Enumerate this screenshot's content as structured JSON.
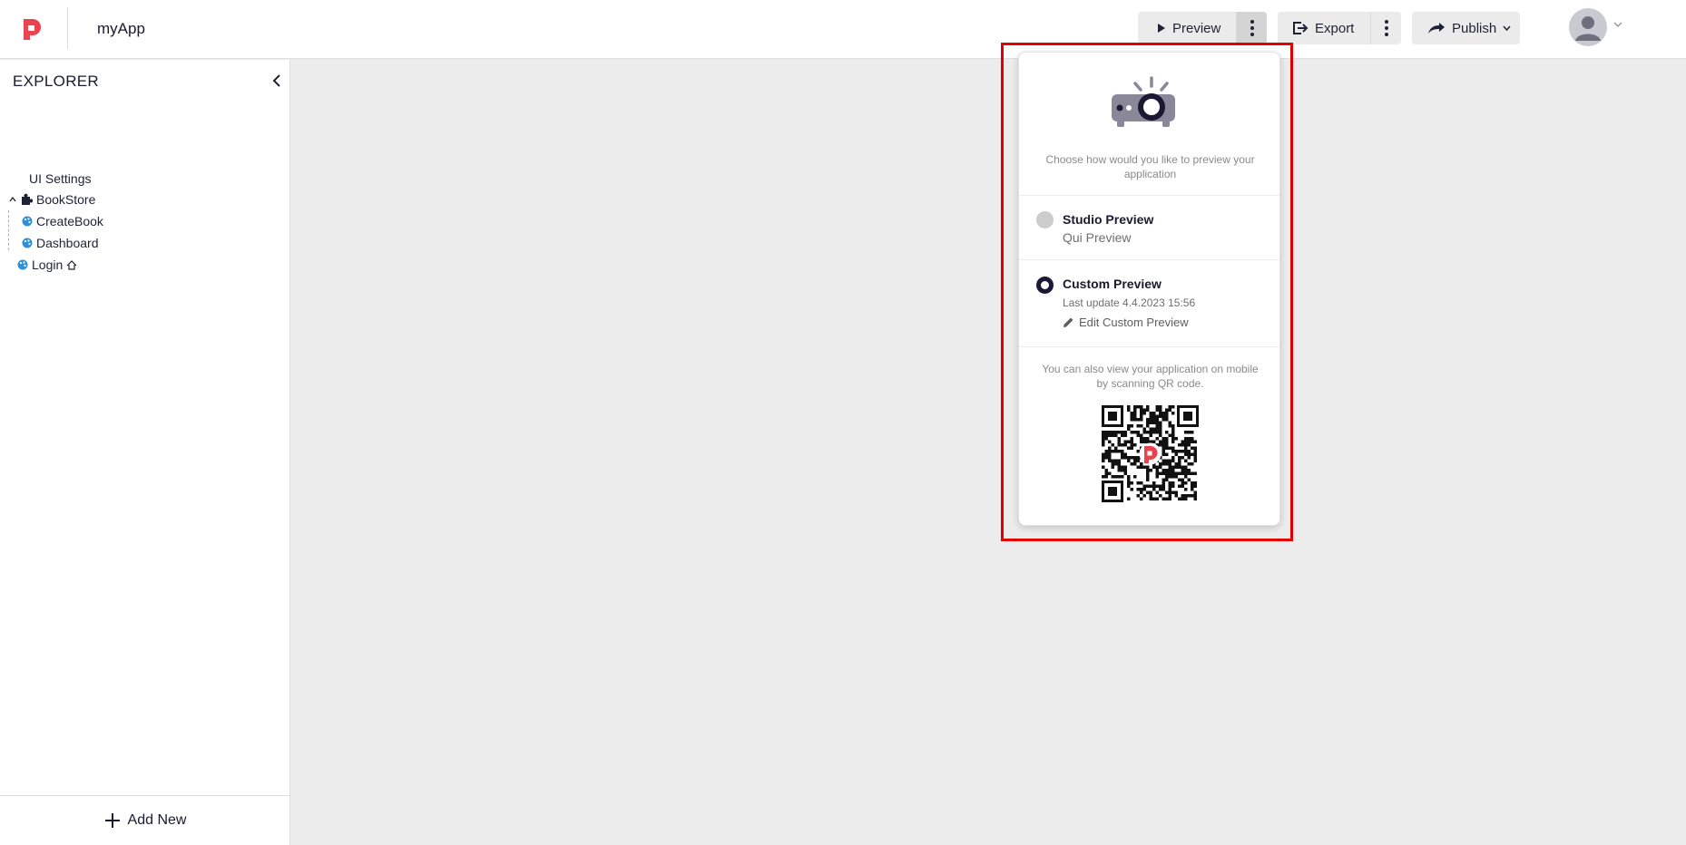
{
  "header": {
    "app_name": "myApp",
    "preview_label": "Preview",
    "export_label": "Export",
    "publish_label": "Publish"
  },
  "sidebar": {
    "title": "EXPLORER",
    "items": [
      {
        "label": "UI Settings",
        "icon": "none"
      },
      {
        "label": "BookStore",
        "icon": "puzzle-icon",
        "expanded": true
      },
      {
        "label": "CreateBook",
        "icon": "palette-icon"
      },
      {
        "label": "Dashboard",
        "icon": "palette-icon"
      },
      {
        "label": "Login",
        "icon": "palette-icon",
        "badge": "home-icon"
      }
    ],
    "add_new_label": "Add New"
  },
  "preview_popover": {
    "description": "Choose how would you like to preview your application",
    "options": [
      {
        "title": "Studio Preview",
        "subtitle": "Qui Preview",
        "selected": false
      },
      {
        "title": "Custom Preview",
        "meta": "Last update 4.4.2023 15:56",
        "action": "Edit Custom Preview",
        "selected": true
      }
    ],
    "mobile_note": "You can also view your application on mobile by scanning QR code."
  },
  "colors": {
    "brand": "#e8434f",
    "radio_selected": "#1b1834",
    "highlight": "#e00000"
  }
}
